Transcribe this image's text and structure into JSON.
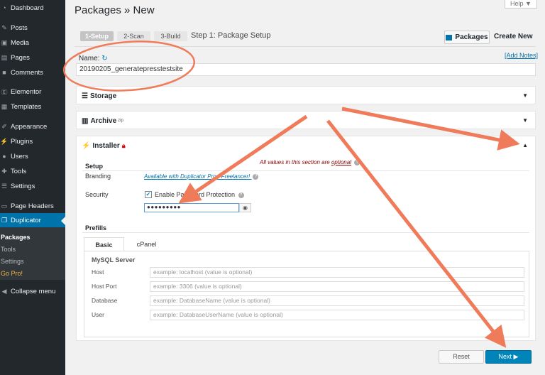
{
  "help": {
    "label": "Help ▼"
  },
  "sidebar": {
    "items": [
      {
        "label": "Dashboard",
        "icon": "dashboard-icon"
      },
      {
        "label": "Posts",
        "icon": "pin-icon"
      },
      {
        "label": "Media",
        "icon": "media-icon"
      },
      {
        "label": "Pages",
        "icon": "pages-icon"
      },
      {
        "label": "Comments",
        "icon": "comments-icon"
      },
      {
        "label": "Elementor",
        "icon": "elementor-icon"
      },
      {
        "label": "Templates",
        "icon": "templates-icon"
      },
      {
        "label": "Appearance",
        "icon": "appearance-icon"
      },
      {
        "label": "Plugins",
        "icon": "plugins-icon"
      },
      {
        "label": "Users",
        "icon": "users-icon"
      },
      {
        "label": "Tools",
        "icon": "tools-icon"
      },
      {
        "label": "Settings",
        "icon": "settings-icon"
      },
      {
        "label": "Page Headers",
        "icon": "page-headers-icon"
      },
      {
        "label": "Duplicator",
        "icon": "duplicator-icon"
      }
    ],
    "submenu": [
      "Packages",
      "Tools",
      "Settings",
      "Go Pro!"
    ],
    "collapse": "Collapse menu"
  },
  "page": {
    "title": "Packages » New",
    "wizard": [
      "1-Setup",
      "2-Scan",
      "3-Build"
    ],
    "step_title": "Step 1: Package Setup",
    "packages_button": "Packages",
    "create_new": "Create New"
  },
  "name": {
    "label": "Name:",
    "value": "20190205_generatepresstestsite",
    "add_notes": "[Add Notes]"
  },
  "panels": {
    "storage": "Storage",
    "archive": "Archive",
    "archive_sup": "zip",
    "installer": "Installer"
  },
  "installer": {
    "note_prefix": "All values in this section are",
    "note_optional": "optional",
    "setup_title": "Setup",
    "branding_label": "Branding",
    "branding_link": "Available with Duplicator Pro - Freelancer!",
    "security_label": "Security",
    "password_toggle": "Enable Password Protection",
    "password_mask": "●●●●●●●●●",
    "prefills_title": "Prefills",
    "tabs": [
      "Basic",
      "cPanel"
    ],
    "mysql_title": "MySQL Server",
    "fields": [
      {
        "label": "Host",
        "placeholder": "example: localhost (value is optional)"
      },
      {
        "label": "Host Port",
        "placeholder": "example: 3306 (value is optional)"
      },
      {
        "label": "Database",
        "placeholder": "example: DatabaseName (value is optional)"
      },
      {
        "label": "User",
        "placeholder": "example: DatabaseUserName (value is optional)"
      }
    ]
  },
  "footer": {
    "reset": "Reset",
    "next": "Next ▶"
  },
  "colors": {
    "sidebar_bg": "#23282d",
    "accent": "#0073aa",
    "annotation": "#ef7b5a"
  }
}
